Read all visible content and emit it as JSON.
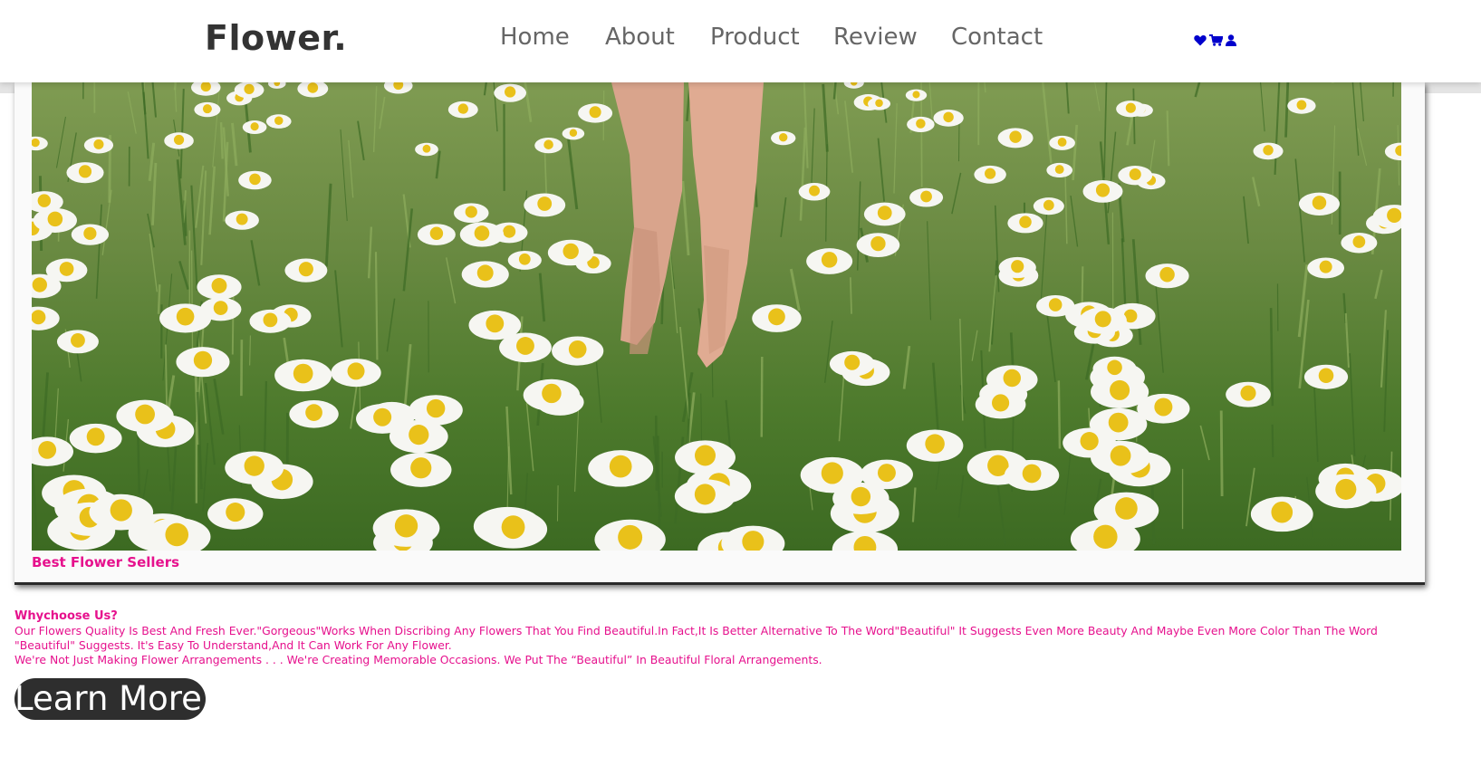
{
  "header": {
    "logo": "Flower.",
    "nav": [
      "Home",
      "About",
      "Product",
      "Review",
      "Contact"
    ],
    "icons": [
      "heart-icon",
      "cart-icon",
      "user-icon"
    ]
  },
  "hero": {
    "caption": "Best Flower Sellers"
  },
  "why": {
    "title": "Whychoose Us?",
    "paragraph1": "Our Flowers Quality Is Best And Fresh Ever.\"Gorgeous\"Works When Discribing Any Flowers That You Find Beautiful.In Fact,It Is Better Alternative To The Word\"Beautiful\" It Suggests Even More Beauty And Maybe Even More Color Than The Word \"Beautiful\" Suggests. It's Easy To Understand,And It Can Work For Any Flower.",
    "paragraph2": "We're Not Just Making Flower Arrangements . . . We're Creating Memorable Occasions. We Put The “Beautiful” In Beautiful Floral Arrangements."
  },
  "cta": {
    "label": "Learn More"
  },
  "colors": {
    "accent": "#e6118d",
    "logo": "#333333",
    "nav": "#666666",
    "icon": "#0000cc",
    "button_bg": "#2e2e2e"
  }
}
